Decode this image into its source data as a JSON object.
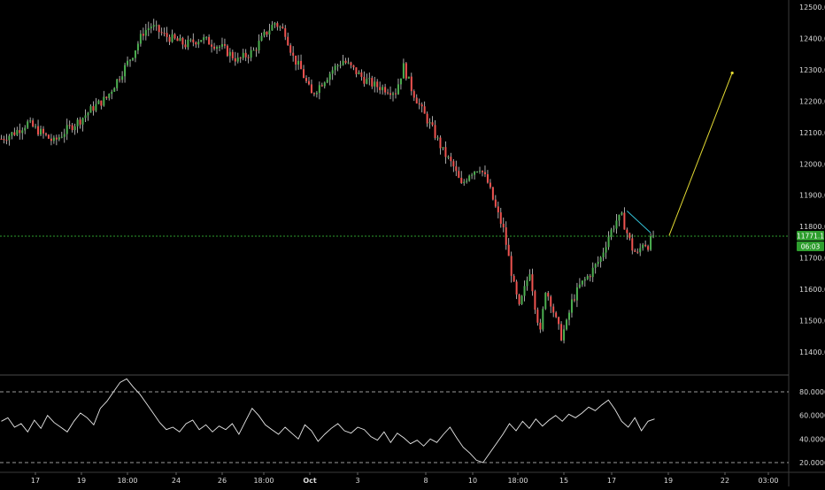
{
  "colors": {
    "background": "#000000",
    "grid": "#ffffff",
    "up": "#4caf50",
    "down": "#ef5350",
    "wick": "#d0d0d0",
    "price_line": "#2e9e2e",
    "price_label_bg": "#2e9e2e",
    "trend_line": "#33c3d8",
    "projection_line": "#e4db33",
    "rsi_line": "#e8e8e8",
    "axis_text": "#d9d9d9"
  },
  "chart_data": [
    {
      "type": "candlestick",
      "title": "",
      "x_tick_labels": [
        "17",
        "19",
        "18:00",
        "24",
        "26",
        "18:00",
        "Oct",
        "3",
        "8",
        "10",
        "18:00",
        "15",
        "17",
        "19",
        "22",
        "03:00"
      ],
      "y_tick_labels": [
        "12500.0",
        "12400.0",
        "12300.0",
        "12200.0",
        "12100.0",
        "12000.0",
        "11900.0",
        "11800.0",
        "11700.0",
        "11600.0",
        "11500.0",
        "11400.0"
      ],
      "ylim": [
        11365,
        12510
      ],
      "last_price": 11771.1,
      "last_price_label": "11771.1",
      "countdown_label": "06:03",
      "price_path": [
        [
          0,
          12080
        ],
        [
          5,
          12100
        ],
        [
          10,
          12130
        ],
        [
          15,
          12100
        ],
        [
          20,
          12070
        ],
        [
          25,
          12110
        ],
        [
          30,
          12140
        ],
        [
          35,
          12180
        ],
        [
          40,
          12210
        ],
        [
          45,
          12280
        ],
        [
          50,
          12350
        ],
        [
          54,
          12420
        ],
        [
          57,
          12440
        ],
        [
          62,
          12410
        ],
        [
          70,
          12380
        ],
        [
          76,
          12400
        ],
        [
          84,
          12370
        ],
        [
          90,
          12330
        ],
        [
          96,
          12360
        ],
        [
          100,
          12410
        ],
        [
          104,
          12450
        ],
        [
          108,
          12420
        ],
        [
          111,
          12340
        ],
        [
          114,
          12300
        ],
        [
          118,
          12220
        ],
        [
          122,
          12260
        ],
        [
          126,
          12300
        ],
        [
          130,
          12330
        ],
        [
          134,
          12300
        ],
        [
          138,
          12270
        ],
        [
          142,
          12250
        ],
        [
          146,
          12240
        ],
        [
          150,
          12230
        ],
        [
          153,
          12310
        ],
        [
          156,
          12240
        ],
        [
          160,
          12170
        ],
        [
          164,
          12110
        ],
        [
          168,
          12040
        ],
        [
          172,
          11990
        ],
        [
          175,
          11930
        ],
        [
          178,
          11970
        ],
        [
          182,
          11990
        ],
        [
          185,
          11940
        ],
        [
          188,
          11860
        ],
        [
          191,
          11790
        ],
        [
          193,
          11700
        ],
        [
          195,
          11610
        ],
        [
          197,
          11540
        ],
        [
          199,
          11600
        ],
        [
          201,
          11660
        ],
        [
          203,
          11550
        ],
        [
          205,
          11460
        ],
        [
          207,
          11600
        ],
        [
          209,
          11560
        ],
        [
          211,
          11500
        ],
        [
          213,
          11450
        ],
        [
          215,
          11490
        ],
        [
          217,
          11560
        ],
        [
          220,
          11610
        ],
        [
          224,
          11650
        ],
        [
          228,
          11700
        ],
        [
          231,
          11770
        ],
        [
          234,
          11820
        ],
        [
          236,
          11830
        ],
        [
          238,
          11780
        ],
        [
          240,
          11730
        ],
        [
          242,
          11710
        ],
        [
          244,
          11750
        ],
        [
          246,
          11740
        ],
        [
          248,
          11771
        ]
      ],
      "trend_line": [
        [
          238,
          11850
        ],
        [
          247,
          11780
        ]
      ],
      "projection_line": [
        [
          254,
          11771
        ],
        [
          278,
          12290
        ]
      ]
    },
    {
      "type": "line",
      "title": "",
      "y_tick_labels": [
        "80.0000",
        "60.0000",
        "40.0000",
        "20.0000"
      ],
      "ylim": [
        17,
        93
      ],
      "reference_lines": [
        80,
        20
      ],
      "series": [
        {
          "values": [
            55,
            58,
            50,
            53,
            46,
            56,
            49,
            60,
            54,
            50,
            46,
            55,
            62,
            58,
            52,
            66,
            72,
            80,
            88,
            91,
            84,
            78,
            70,
            62,
            54,
            48,
            50,
            46,
            53,
            56,
            48,
            52,
            46,
            51,
            48,
            53,
            44,
            55,
            66,
            60,
            52,
            48,
            44,
            50,
            45,
            40,
            52,
            47,
            38,
            44,
            49,
            53,
            47,
            45,
            50,
            48,
            42,
            39,
            46,
            37,
            45,
            41,
            36,
            39,
            34,
            40,
            37,
            44,
            50,
            41,
            33,
            28,
            22,
            20,
            28,
            36,
            44,
            53,
            47,
            55,
            49,
            57,
            51,
            56,
            60,
            55,
            61,
            58,
            62,
            67,
            64,
            69,
            73,
            65,
            55,
            50,
            58,
            47,
            55,
            57
          ]
        }
      ]
    }
  ]
}
